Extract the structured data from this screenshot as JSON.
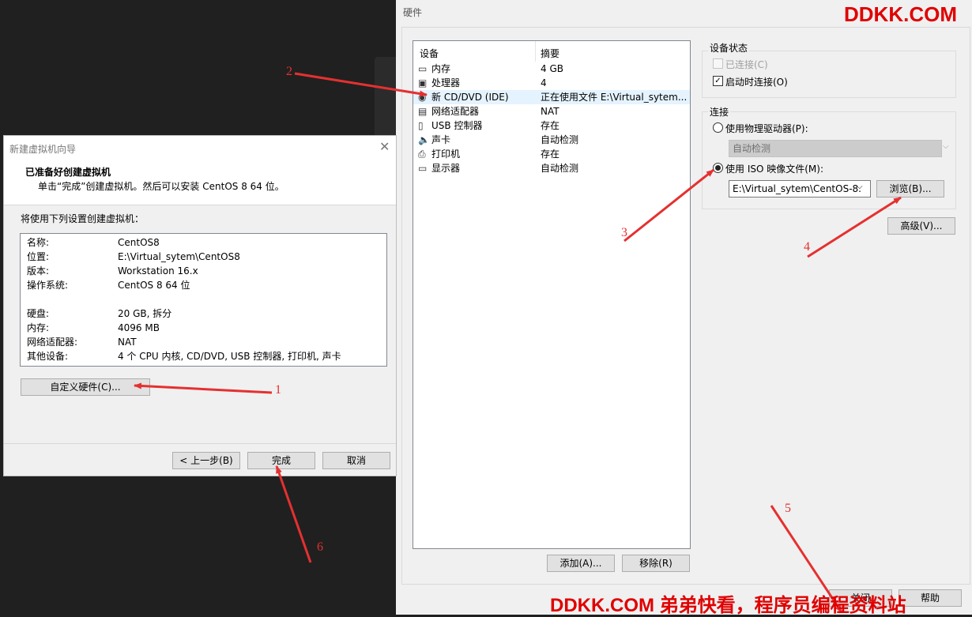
{
  "watermark_top": "DDKK.COM",
  "watermark_bottom": "DDKK.COM 弟弟快看，程序员编程资料站",
  "wizard": {
    "title": "新建虚拟机向导",
    "heading": "已准备好创建虚拟机",
    "subheading": "单击“完成”创建虚拟机。然后可以安装 CentOS 8 64 位。",
    "summary_label": "将使用下列设置创建虚拟机：",
    "summary": [
      {
        "k": "名称:",
        "v": "CentOS8"
      },
      {
        "k": "位置:",
        "v": "E:\\Virtual_sytem\\CentOS8"
      },
      {
        "k": "版本:",
        "v": "Workstation 16.x"
      },
      {
        "k": "操作系统:",
        "v": "CentOS 8 64 位"
      },
      {
        "k": "",
        "v": ""
      },
      {
        "k": "硬盘:",
        "v": "20 GB, 拆分"
      },
      {
        "k": "内存:",
        "v": "4096 MB"
      },
      {
        "k": "网络适配器:",
        "v": "NAT"
      },
      {
        "k": "其他设备:",
        "v": "4 个 CPU 内核, CD/DVD, USB 控制器, 打印机, 声卡"
      }
    ],
    "customize_button": "自定义硬件(C)...",
    "back_button": "< 上一步(B)",
    "finish_button": "完成",
    "cancel_button": "取消"
  },
  "hardware": {
    "title": "硬件",
    "col_device": "设备",
    "col_summary": "摘要",
    "devices": [
      {
        "name": "内存",
        "summary": "4 GB",
        "icon": "memory-icon"
      },
      {
        "name": "处理器",
        "summary": "4",
        "icon": "cpu-icon"
      },
      {
        "name": "新 CD/DVD (IDE)",
        "summary": "正在使用文件 E:\\Virtual_sytem...",
        "icon": "cd-icon"
      },
      {
        "name": "网络适配器",
        "summary": "NAT",
        "icon": "network-icon"
      },
      {
        "name": "USB 控制器",
        "summary": "存在",
        "icon": "usb-icon"
      },
      {
        "name": "声卡",
        "summary": "自动检测",
        "icon": "speaker-icon"
      },
      {
        "name": "打印机",
        "summary": "存在",
        "icon": "printer-icon"
      },
      {
        "name": "显示器",
        "summary": "自动检测",
        "icon": "monitor-icon"
      }
    ],
    "add_button": "添加(A)...",
    "remove_button": "移除(R)",
    "device_status_label": "设备状态",
    "connected_label": "已连接(C)",
    "connect_at_power_on_label": "启动时连接(O)",
    "connection_label": "连接",
    "physical_drive_label": "使用物理驱动器(P):",
    "physical_drive_value": "自动检测",
    "iso_label": "使用 ISO 映像文件(M):",
    "iso_value": "E:\\Virtual_sytem\\CentOS-8.",
    "browse_button": "浏览(B)...",
    "advanced_button": "高级(V)...",
    "close_button": "关闭",
    "help_button": "帮助"
  },
  "annotations": [
    "1",
    "2",
    "3",
    "4",
    "5",
    "6"
  ],
  "colors": {
    "arrow": "#e53030",
    "watermark": "#e00000",
    "selection": "#cce8ff"
  }
}
